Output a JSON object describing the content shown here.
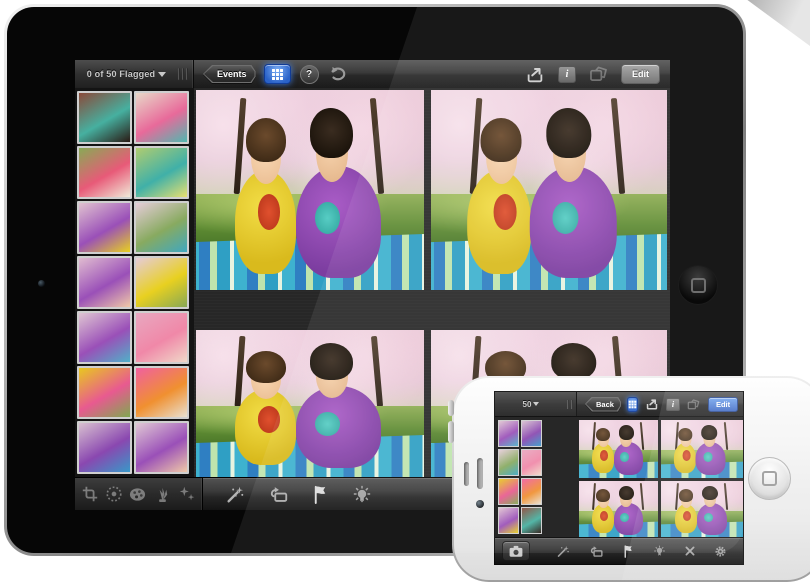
{
  "colors": {
    "grid_button_blue": "#3f7de0",
    "iphone_edit_button_blue": "#4a7fd6",
    "toolbar_dark": "#2a2a2a",
    "page_background": "#ffffff"
  },
  "ipad": {
    "top_toolbar": {
      "flag_counter": "0 of 50 Flagged",
      "events_button": "Events",
      "help_button": "?",
      "edit_button": "Edit",
      "icons": [
        "thumbnail-grid-icon",
        "help-icon",
        "undo-icon",
        "share-icon",
        "info-icon",
        "compare-icon"
      ]
    },
    "sidebar": {
      "thumbnails": [
        {
          "colors": [
            "#8a4a3a",
            "#46b0a0",
            "#2a1a14"
          ]
        },
        {
          "colors": [
            "#e8d8c8",
            "#e86a9a",
            "#50b8b0"
          ]
        },
        {
          "colors": [
            "#88aa55",
            "#e85a78",
            "#f0ead8"
          ]
        },
        {
          "colors": [
            "#b0cc70",
            "#40b0a8",
            "#e8e070"
          ]
        },
        {
          "colors": [
            "#e0c2d0",
            "#9a50b8",
            "#e8d020"
          ]
        },
        {
          "colors": [
            "#e5cdd8",
            "#88aa60",
            "#40a8c0"
          ]
        },
        {
          "colors": [
            "#e0bcd0",
            "#9a50b8",
            "#f0c8a8"
          ]
        },
        {
          "colors": [
            "#e5ccd8",
            "#e8d020",
            "#88a855"
          ]
        },
        {
          "colors": [
            "#dfc5d2",
            "#9a50b8",
            "#50b0c8"
          ]
        },
        {
          "colors": [
            "#e8a8c0",
            "#f088a8",
            "#f0d8c8"
          ]
        },
        {
          "colors": [
            "#e8c820",
            "#e85a90",
            "#80a850"
          ]
        },
        {
          "colors": [
            "#f060a0",
            "#f09030",
            "#e8e0d0"
          ]
        },
        {
          "colors": [
            "#d8c0d0",
            "#8a48b0",
            "#3898c8"
          ]
        },
        {
          "colors": [
            "#e0c8d4",
            "#9a50b8",
            "#f0c8a8"
          ]
        }
      ]
    },
    "photo_grid": {
      "count": 4,
      "subject": "Couple on a striped picnic blanket under cherry blossom trees"
    },
    "bottom_toolbar": {
      "icons": [
        "crop-icon",
        "exposure-icon",
        "color-icon",
        "brushes-icon",
        "effects-icon",
        "auto-enhance-icon",
        "copy-compare-icon",
        "flag-icon",
        "tag-badge-icon"
      ]
    }
  },
  "iphone": {
    "top_toolbar": {
      "photo_counter": "50",
      "back_button": "Back",
      "edit_button": "Edit",
      "icons": [
        "thumbnail-grid-icon",
        "share-icon",
        "info-icon",
        "compare-icon"
      ]
    },
    "thumbnails": [
      {
        "colors": [
          "#dfc5d2",
          "#9a50b8",
          "#50b0c8"
        ]
      },
      {
        "colors": [
          "#d8c0d0",
          "#8a48b0",
          "#3898c8"
        ]
      },
      {
        "colors": [
          "#e5cdd8",
          "#88aa60",
          "#40a8c0"
        ]
      },
      {
        "colors": [
          "#e8a8c0",
          "#f088a8",
          "#f0d8c8"
        ]
      },
      {
        "colors": [
          "#e8c820",
          "#e85a90",
          "#80a850"
        ]
      },
      {
        "colors": [
          "#f060a0",
          "#f09030",
          "#e8e0d0"
        ]
      },
      {
        "colors": [
          "#e0c2d0",
          "#9a50b8",
          "#e8d020"
        ]
      },
      {
        "colors": [
          "#8a4a3a",
          "#46b0a0",
          "#2a1a14"
        ]
      }
    ],
    "photo_grid": {
      "count": 4,
      "subject": "Couple on a striped picnic blanket under cherry blossom trees"
    },
    "bottom_toolbar": {
      "icons": [
        "camera-icon",
        "auto-enhance-icon",
        "copy-compare-icon",
        "flag-icon",
        "tag-badge-icon",
        "delete-x-icon",
        "settings-gear-icon"
      ]
    }
  }
}
